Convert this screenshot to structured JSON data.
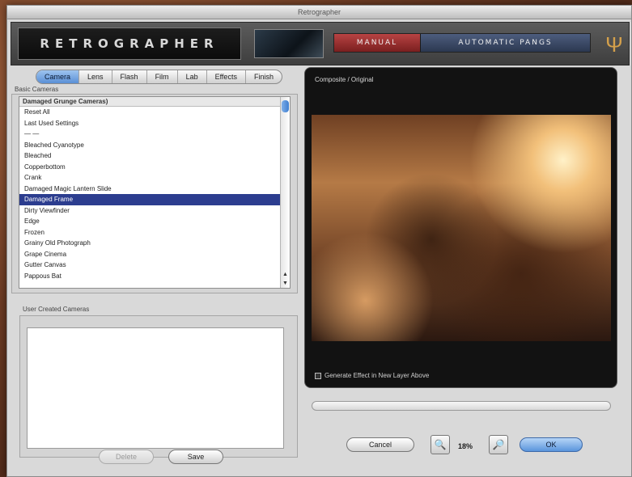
{
  "window": {
    "title": "Retrographer"
  },
  "header": {
    "logo": "RETROGRAPHER",
    "mode_manual": "MANUAL",
    "mode_auto": "AUTOMATIC PANGS",
    "brand_icon": "tuning-fork-icon"
  },
  "tabs": [
    "Camera",
    "Lens",
    "Flash",
    "Film",
    "Lab",
    "Effects",
    "Finish"
  ],
  "active_tab": "Camera",
  "basic": {
    "group_label": "Basic Cameras",
    "list_header": "Damaged Grunge Cameras)",
    "items": [
      "Reset All",
      "Last Used Settings",
      "— —",
      "Bleached Cyanotype",
      "Bleached",
      "Copperbottom",
      "Crank",
      "Damaged Magic Lantern Slide",
      "Damaged Frame",
      "Dirty Viewfinder",
      "Edge",
      "Frozen",
      "Grainy Old Photograph",
      "Grape Cinema",
      "Gutter Canvas",
      "Pappous Bat"
    ],
    "selected_index": 8
  },
  "user": {
    "group_label": "User Created Cameras",
    "delete_label": "Delete",
    "save_label": "Save"
  },
  "preview": {
    "label": "Composite / Original",
    "generate_label": "Generate Effect in New Layer Above"
  },
  "bottom": {
    "cancel_label": "Cancel",
    "zoom_label": "18%",
    "ok_label": "OK",
    "zoom_in_icon": "magnifier-zoom-in-icon",
    "zoom_out_icon": "magnifier-zoom-out-icon"
  }
}
